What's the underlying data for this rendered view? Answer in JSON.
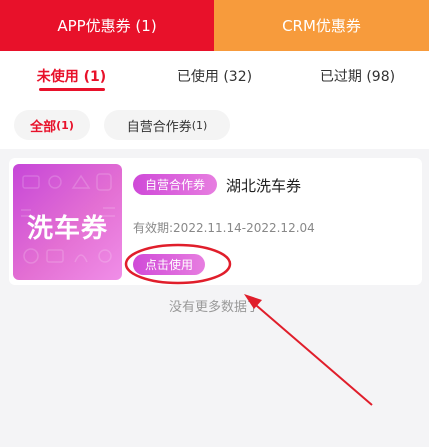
{
  "top_tabs": {
    "app": "APP优惠券 (1)",
    "crm": "CRM优惠券"
  },
  "status_tabs": {
    "unused": "未使用 (1)",
    "used": "已使用 (32)",
    "expired": "已过期 (98)"
  },
  "filters": {
    "all_label": "全部",
    "all_count": "(1)",
    "coop_label": "自营合作券",
    "coop_count": "(1)"
  },
  "coupon": {
    "thumb_text": "洗车券",
    "tag": "自营合作券",
    "title": "湖北洗车券",
    "validity": "有效期:2022.11.14-2022.12.04",
    "use_button": "点击使用"
  },
  "footer": {
    "no_more": "没有更多数据了"
  },
  "colors": {
    "primary_red": "#e8112a",
    "orange": "#f79b3c",
    "pink_purple": "#d04ad8",
    "annotation_red": "#e01e2b"
  }
}
